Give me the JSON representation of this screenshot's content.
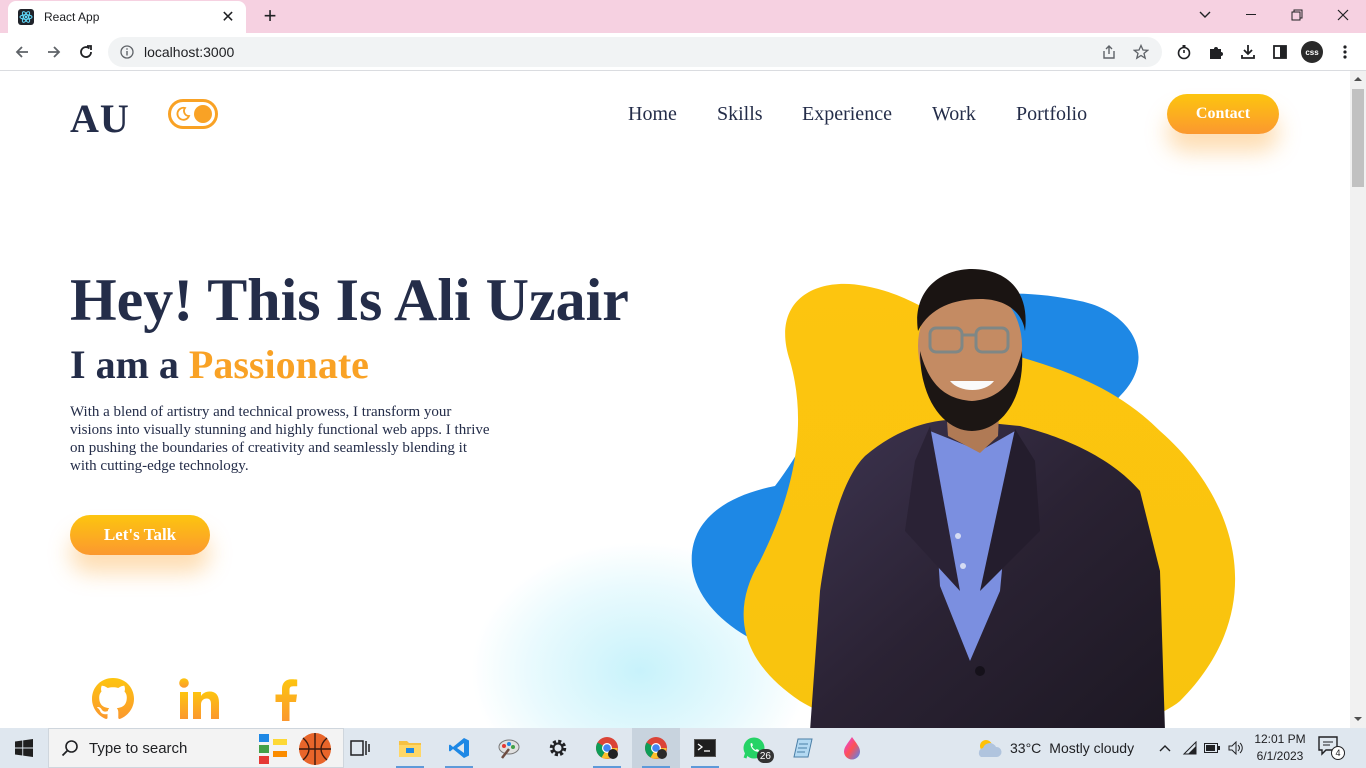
{
  "browser": {
    "tab_title": "React App",
    "url": "localhost:3000",
    "profile_label": "css"
  },
  "site": {
    "logo": "AU",
    "nav": [
      "Home",
      "Skills",
      "Experience",
      "Work",
      "Portfolio"
    ],
    "contact_label": "Contact",
    "hero": {
      "title": "Hey! This Is Ali Uzair",
      "sub_prefix": "I am a",
      "sub_accent": "Passionate",
      "description": "With a blend of artistry and technical prowess, I transform your visions into visually stunning and highly functional web apps. I thrive on pushing the boundaries of creativity and seamlessly blending it with cutting-edge technology.",
      "cta_label": "Let's Talk"
    },
    "social": [
      "github-icon",
      "linkedin-icon",
      "facebook-icon"
    ],
    "colors": {
      "primary_text": "#242d49",
      "accent_orange": "#f9a225",
      "accent_yellow": "#fdc50f",
      "blob_blue": "#1e88e5"
    }
  },
  "taskbar": {
    "search_placeholder": "Type to search",
    "whatsapp_badge": "26",
    "weather_temp": "33°C",
    "weather_text": "Mostly cloudy",
    "time": "12:01 PM",
    "date": "6/1/2023",
    "notification_count": "4"
  }
}
